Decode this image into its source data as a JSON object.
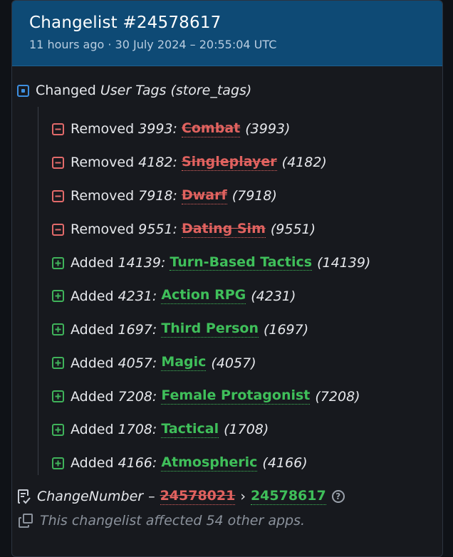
{
  "header": {
    "title": "Changelist #24578617",
    "subtitle": "11 hours ago · 30 July 2024 – 20:55:04 UTC"
  },
  "section": {
    "prefix": "Changed",
    "field": "User Tags (store_tags)"
  },
  "changes": [
    {
      "action": "Removed",
      "id": "3993:",
      "name": "Combat",
      "paren": "(3993)",
      "type": "removed"
    },
    {
      "action": "Removed",
      "id": "4182:",
      "name": "Singleplayer",
      "paren": "(4182)",
      "type": "removed"
    },
    {
      "action": "Removed",
      "id": "7918:",
      "name": "Dwarf",
      "paren": "(7918)",
      "type": "removed"
    },
    {
      "action": "Removed",
      "id": "9551:",
      "name": "Dating Sim",
      "paren": "(9551)",
      "type": "removed"
    },
    {
      "action": "Added",
      "id": "14139:",
      "name": "Turn-Based Tactics",
      "paren": "(14139)",
      "type": "added"
    },
    {
      "action": "Added",
      "id": "4231:",
      "name": "Action RPG",
      "paren": "(4231)",
      "type": "added"
    },
    {
      "action": "Added",
      "id": "1697:",
      "name": "Third Person",
      "paren": "(1697)",
      "type": "added"
    },
    {
      "action": "Added",
      "id": "4057:",
      "name": "Magic",
      "paren": "(4057)",
      "type": "added"
    },
    {
      "action": "Added",
      "id": "7208:",
      "name": "Female Protagonist",
      "paren": "(7208)",
      "type": "added"
    },
    {
      "action": "Added",
      "id": "1708:",
      "name": "Tactical",
      "paren": "(1708)",
      "type": "added"
    },
    {
      "action": "Added",
      "id": "4166:",
      "name": "Atmospheric",
      "paren": "(4166)",
      "type": "added"
    }
  ],
  "change_number": {
    "label": "ChangeNumber",
    "dash": "–",
    "old": "24578021",
    "arrow": "›",
    "new": "24578617",
    "help": "?"
  },
  "footer": {
    "other_apps": "This changelist affected 54 other apps."
  },
  "icons": {
    "changed": "modified-square-icon",
    "removed": "minus-square-icon",
    "added": "plus-square-icon",
    "change_number": "document-check-icon",
    "other_apps": "copy-icon",
    "help": "help-circle-icon"
  },
  "colors": {
    "header_bg": "#0e4a75",
    "removed": "#e0625f",
    "added": "#3fbf5a",
    "changed": "#3d8fe0"
  }
}
